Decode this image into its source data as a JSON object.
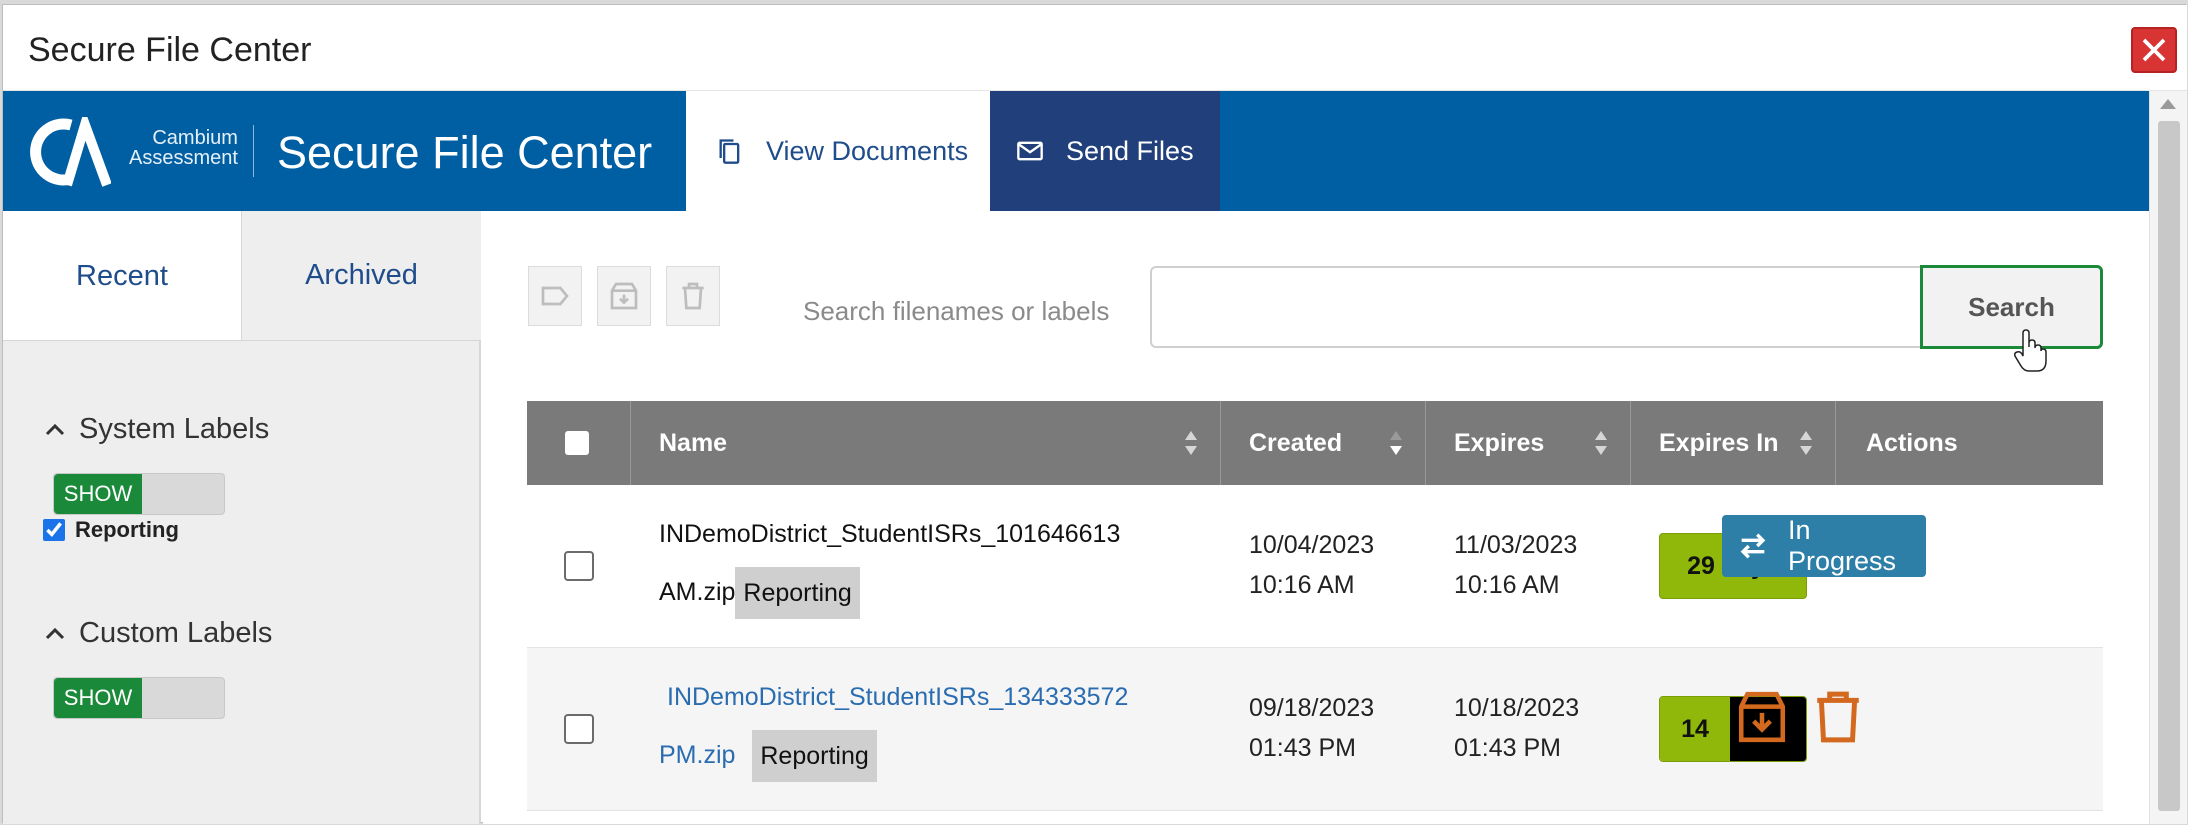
{
  "window": {
    "title": "Secure File Center"
  },
  "header": {
    "logo_line1": "Cambium",
    "logo_line2": "Assessment",
    "app_title": "Secure File Center",
    "tabs": [
      {
        "label": "View Documents",
        "icon": "copy-icon",
        "active": true
      },
      {
        "label": "Send Files",
        "icon": "mail-icon",
        "active": false
      }
    ]
  },
  "sidebar": {
    "tabs": [
      {
        "label": "Recent"
      },
      {
        "label": "Archived"
      }
    ],
    "system_labels": {
      "title": "System Labels",
      "toggle": "SHOW",
      "items": [
        {
          "label": "Reporting",
          "checked": true
        }
      ]
    },
    "custom_labels": {
      "title": "Custom Labels",
      "toggle": "SHOW"
    }
  },
  "toolbar": {
    "search_label": "Search filenames or labels",
    "search_value": "",
    "search_button": "Search"
  },
  "table": {
    "columns": [
      "Name",
      "Created",
      "Expires",
      "Expires In",
      "Actions"
    ],
    "rows": [
      {
        "name_line1": "INDemoDistrict_StudentISRs_101646613",
        "name_line2": "AM.zip",
        "label": "Reporting",
        "created_date": "10/04/2023",
        "created_time": "10:16 AM",
        "expires_date": "11/03/2023",
        "expires_time": "10:16 AM",
        "expires_in": "29 days",
        "action": "In Progress"
      },
      {
        "name_line1": "INDemoDistrict_StudentISRs_134333572",
        "name_line2": "PM.zip",
        "label": "Reporting",
        "created_date": "09/18/2023",
        "created_time": "01:43 PM",
        "expires_date": "10/18/2023",
        "expires_time": "01:43 PM",
        "expires_in": "14"
      }
    ]
  },
  "colors": {
    "header_blue": "#005fa3",
    "send_tab": "#213f7a",
    "show_green": "#1a8a3a",
    "badge_green": "#8fb80a",
    "action_orange": "#d2691e",
    "progress_blue": "#2e7fa8",
    "close_red": "#d93434"
  }
}
